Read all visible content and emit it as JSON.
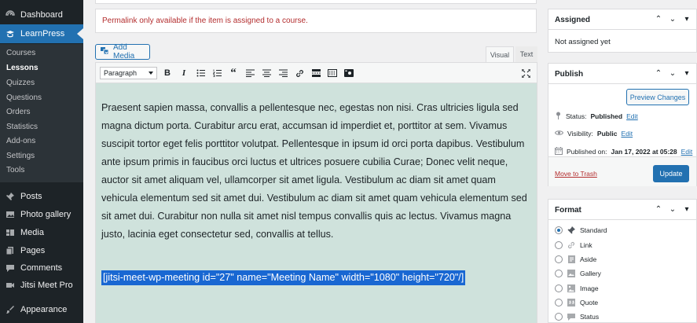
{
  "sidebar": {
    "top_items": [
      {
        "label": "Dashboard",
        "icon": "dashboard-icon"
      },
      {
        "label": "LearnPress",
        "icon": "learnpress-icon"
      }
    ],
    "learnpress_submenu": [
      "Courses",
      "Lessons",
      "Quizzes",
      "Questions",
      "Orders",
      "Statistics",
      "Add-ons",
      "Settings",
      "Tools"
    ],
    "current_submenu": "Lessons",
    "bottom_items": [
      {
        "label": "Posts",
        "icon": "pin-icon"
      },
      {
        "label": "Photo gallery",
        "icon": "gallery-icon"
      },
      {
        "label": "Media",
        "icon": "media-icon"
      },
      {
        "label": "Pages",
        "icon": "pages-icon"
      },
      {
        "label": "Comments",
        "icon": "comments-icon"
      },
      {
        "label": "Jitsi Meet Pro",
        "icon": "video-icon"
      },
      {
        "label": "Appearance",
        "icon": "brush-icon"
      }
    ]
  },
  "editor": {
    "permalink_notice": "Permalink only available if the item is assigned to a course.",
    "add_media_label": "Add Media",
    "tab_visual": "Visual",
    "tab_text": "Text",
    "format_select_value": "Paragraph",
    "paragraph_text": "Praesent sapien massa, convallis a pellentesque nec, egestas non nisi. Cras ultricies ligula sed magna dictum porta. Curabitur arcu erat, accumsan id imperdiet et, porttitor at sem. Vivamus suscipit tortor eget felis porttitor volutpat. Pellentesque in ipsum id orci porta dapibus. Vestibulum ante ipsum primis in faucibus orci luctus et ultrices posuere cubilia Curae; Donec velit neque, auctor sit amet aliquam vel, ullamcorper sit amet ligula. Vestibulum ac diam sit amet quam vehicula elementum sed sit amet dui. Vestibulum ac diam sit amet quam vehicula elementum sed sit amet dui. Curabitur non nulla sit amet nisl tempus convallis quis ac lectus. Vivamus magna justo, lacinia eget consectetur sed, convallis at tellus.",
    "shortcode_text": "[jitsi-meet-wp-meeting id=\"27\" name=\"Meeting Name\" width=\"1080\" height=\"720\"/]",
    "toolbar_icons": [
      "bold-icon",
      "italic-icon",
      "bullet-list-icon",
      "numbered-list-icon",
      "blockquote-icon",
      "align-left-icon",
      "align-center-icon",
      "align-right-icon",
      "link-icon",
      "read-more-icon",
      "toolbar-toggle-icon",
      "media-embed-icon",
      "fullscreen-icon"
    ]
  },
  "assigned_box": {
    "title": "Assigned",
    "value": "Not assigned yet"
  },
  "publish_box": {
    "title": "Publish",
    "preview_label": "Preview Changes",
    "status_label": "Status:",
    "status_value": "Published",
    "visibility_label": "Visibility:",
    "visibility_value": "Public",
    "published_label": "Published on:",
    "published_value": "Jan 17, 2022 at 05:28",
    "edit_label": "Edit",
    "trash_label": "Move to Trash",
    "update_label": "Update"
  },
  "format_box": {
    "title": "Format",
    "options": [
      {
        "label": "Standard",
        "icon": "pin-icon",
        "checked": true
      },
      {
        "label": "Link",
        "icon": "link-icon",
        "checked": false
      },
      {
        "label": "Aside",
        "icon": "aside-icon",
        "checked": false
      },
      {
        "label": "Gallery",
        "icon": "gallery-icon",
        "checked": false
      },
      {
        "label": "Image",
        "icon": "image-icon",
        "checked": false
      },
      {
        "label": "Quote",
        "icon": "quote-icon",
        "checked": false
      },
      {
        "label": "Status",
        "icon": "status-icon",
        "checked": false
      }
    ]
  },
  "colors": {
    "sidebar_bg": "#1d2327",
    "accent": "#2271b1",
    "editor_bg": "#cfe2dc",
    "selection": "#1967d2",
    "danger": "#b32d2e"
  }
}
